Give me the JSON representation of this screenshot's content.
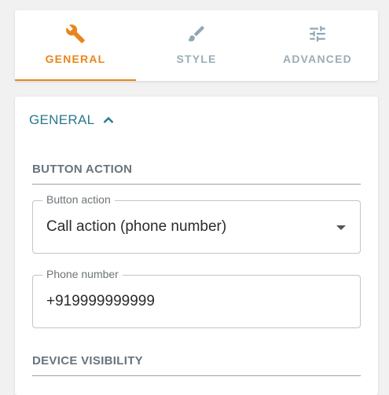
{
  "tabs": [
    {
      "label": "GENERAL",
      "icon": "wrench-icon",
      "active": true
    },
    {
      "label": "STYLE",
      "icon": "paintbrush-icon",
      "active": false
    },
    {
      "label": "ADVANCED",
      "icon": "sliders-icon",
      "active": false
    }
  ],
  "section": {
    "title": "GENERAL",
    "expanded": true
  },
  "button_action": {
    "group_title": "BUTTON ACTION",
    "select": {
      "label": "Button action",
      "value": "Call action (phone number)"
    },
    "phone": {
      "label": "Phone number",
      "value": "+919999999999"
    }
  },
  "device_visibility": {
    "group_title": "DEVICE VISIBILITY"
  },
  "colors": {
    "accent": "#e8851d",
    "teal": "#2a7a8c",
    "inactive": "#9aaeb6"
  }
}
